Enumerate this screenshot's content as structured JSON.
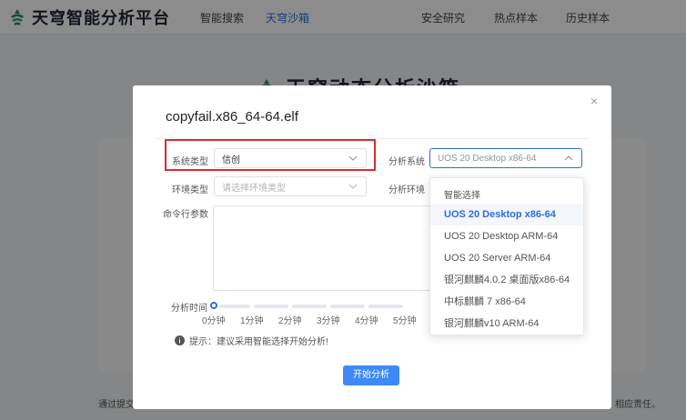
{
  "header": {
    "brand": "天穹智能分析平台",
    "nav_left": [
      "智能搜索",
      "天穹沙箱"
    ],
    "nav_right": [
      "安全研究",
      "热点样本",
      "历史样本"
    ],
    "active": "天穹沙箱"
  },
  "background": {
    "title": "天穹动态分析沙箱",
    "footer_left": "通过提交",
    "footer_right": "相应责任。"
  },
  "modal": {
    "title": "copyfail.x86_64-64.elf",
    "close_symbol": "×",
    "system_type": {
      "label": "系统类型",
      "value": "信创"
    },
    "analysis_system": {
      "label": "分析系统",
      "value": "UOS 20 Desktop x86-64"
    },
    "env_type": {
      "label": "环境类型",
      "placeholder": "请选择环境类型"
    },
    "analysis_env": {
      "label": "分析环境"
    },
    "cmd_params": {
      "label": "命令行参数"
    },
    "analysis_time": {
      "label": "分析时间",
      "ticks": [
        "0分钟",
        "1分钟",
        "2分钟",
        "3分钟",
        "4分钟",
        "5分钟"
      ],
      "value_minutes": 0
    },
    "hint": "提示：建议采用智能选择开始分析!",
    "start_button": "开始分析"
  },
  "dropdown": {
    "group_label": "智能选择",
    "options": [
      "UOS 20 Desktop x86-64",
      "UOS 20 Desktop ARM-64",
      "UOS 20 Server ARM-64",
      "银河麒麟4.0.2 桌面版x86-64",
      "中标麒麟 7 x86-64",
      "银河麒麟v10 ARM-64"
    ],
    "selected_index": 0
  },
  "colors": {
    "accent": "#2d6cdf",
    "button": "#3d8af7",
    "highlight": "#d32f2f",
    "brand_green": "#2e8b6d"
  },
  "icons": {
    "logo": "tianqiong-logo-icon",
    "chevron": "chevron-down-icon",
    "info": "info-icon",
    "close": "close-icon"
  }
}
